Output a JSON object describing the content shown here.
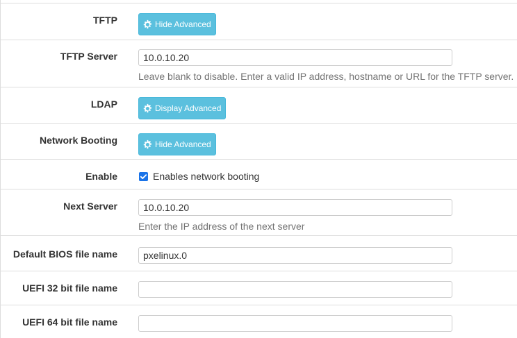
{
  "rows": {
    "tftp": {
      "label": "TFTP",
      "button": "Hide Advanced"
    },
    "tftp_server": {
      "label": "TFTP Server",
      "value": "10.0.10.20",
      "help": "Leave blank to disable. Enter a valid IP address, hostname or URL for the TFTP server."
    },
    "ldap": {
      "label": "LDAP",
      "button": "Display Advanced"
    },
    "network_booting": {
      "label": "Network Booting",
      "button": "Hide Advanced"
    },
    "enable": {
      "label": "Enable",
      "checkbox_label": "Enables network booting",
      "checked": true
    },
    "next_server": {
      "label": "Next Server",
      "value": "10.0.10.20",
      "help": "Enter the IP address of the next server"
    },
    "bios_file": {
      "label": "Default BIOS file name",
      "value": "pxelinux.0"
    },
    "uefi32_file": {
      "label": "UEFI 32 bit file name",
      "value": ""
    },
    "uefi64_file": {
      "label": "UEFI 64 bit file name",
      "value": ""
    }
  },
  "icons": {
    "button_icon": "gear-icon",
    "checkbox_icon": "checkmark-icon"
  },
  "colors": {
    "button_bg": "#5bc0de",
    "checkbox": "#1a73e8",
    "help_text": "#737373"
  }
}
